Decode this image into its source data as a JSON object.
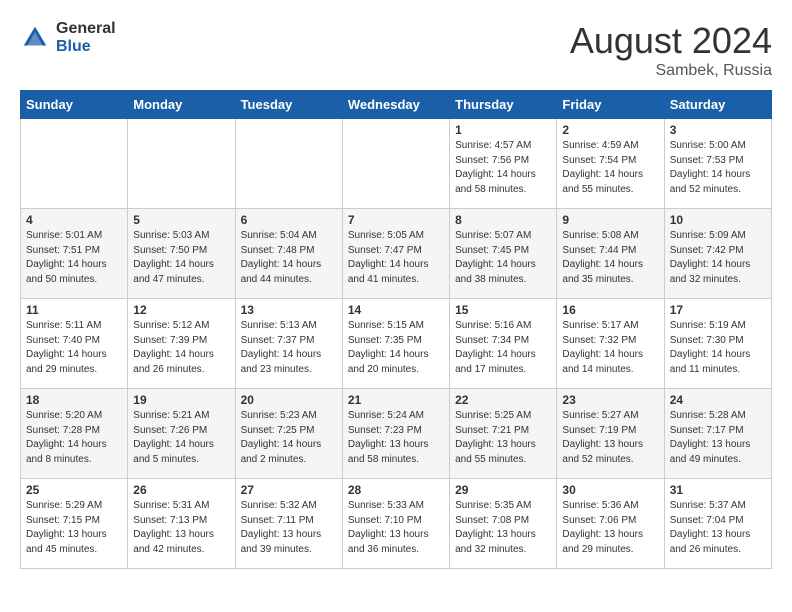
{
  "header": {
    "logo_general": "General",
    "logo_blue": "Blue",
    "month_year": "August 2024",
    "location": "Sambek, Russia"
  },
  "days_of_week": [
    "Sunday",
    "Monday",
    "Tuesday",
    "Wednesday",
    "Thursday",
    "Friday",
    "Saturday"
  ],
  "weeks": [
    [
      {
        "day": "",
        "lines": []
      },
      {
        "day": "",
        "lines": []
      },
      {
        "day": "",
        "lines": []
      },
      {
        "day": "",
        "lines": []
      },
      {
        "day": "1",
        "lines": [
          "Sunrise: 4:57 AM",
          "Sunset: 7:56 PM",
          "Daylight: 14 hours",
          "and 58 minutes."
        ]
      },
      {
        "day": "2",
        "lines": [
          "Sunrise: 4:59 AM",
          "Sunset: 7:54 PM",
          "Daylight: 14 hours",
          "and 55 minutes."
        ]
      },
      {
        "day": "3",
        "lines": [
          "Sunrise: 5:00 AM",
          "Sunset: 7:53 PM",
          "Daylight: 14 hours",
          "and 52 minutes."
        ]
      }
    ],
    [
      {
        "day": "4",
        "lines": [
          "Sunrise: 5:01 AM",
          "Sunset: 7:51 PM",
          "Daylight: 14 hours",
          "and 50 minutes."
        ]
      },
      {
        "day": "5",
        "lines": [
          "Sunrise: 5:03 AM",
          "Sunset: 7:50 PM",
          "Daylight: 14 hours",
          "and 47 minutes."
        ]
      },
      {
        "day": "6",
        "lines": [
          "Sunrise: 5:04 AM",
          "Sunset: 7:48 PM",
          "Daylight: 14 hours",
          "and 44 minutes."
        ]
      },
      {
        "day": "7",
        "lines": [
          "Sunrise: 5:05 AM",
          "Sunset: 7:47 PM",
          "Daylight: 14 hours",
          "and 41 minutes."
        ]
      },
      {
        "day": "8",
        "lines": [
          "Sunrise: 5:07 AM",
          "Sunset: 7:45 PM",
          "Daylight: 14 hours",
          "and 38 minutes."
        ]
      },
      {
        "day": "9",
        "lines": [
          "Sunrise: 5:08 AM",
          "Sunset: 7:44 PM",
          "Daylight: 14 hours",
          "and 35 minutes."
        ]
      },
      {
        "day": "10",
        "lines": [
          "Sunrise: 5:09 AM",
          "Sunset: 7:42 PM",
          "Daylight: 14 hours",
          "and 32 minutes."
        ]
      }
    ],
    [
      {
        "day": "11",
        "lines": [
          "Sunrise: 5:11 AM",
          "Sunset: 7:40 PM",
          "Daylight: 14 hours",
          "and 29 minutes."
        ]
      },
      {
        "day": "12",
        "lines": [
          "Sunrise: 5:12 AM",
          "Sunset: 7:39 PM",
          "Daylight: 14 hours",
          "and 26 minutes."
        ]
      },
      {
        "day": "13",
        "lines": [
          "Sunrise: 5:13 AM",
          "Sunset: 7:37 PM",
          "Daylight: 14 hours",
          "and 23 minutes."
        ]
      },
      {
        "day": "14",
        "lines": [
          "Sunrise: 5:15 AM",
          "Sunset: 7:35 PM",
          "Daylight: 14 hours",
          "and 20 minutes."
        ]
      },
      {
        "day": "15",
        "lines": [
          "Sunrise: 5:16 AM",
          "Sunset: 7:34 PM",
          "Daylight: 14 hours",
          "and 17 minutes."
        ]
      },
      {
        "day": "16",
        "lines": [
          "Sunrise: 5:17 AM",
          "Sunset: 7:32 PM",
          "Daylight: 14 hours",
          "and 14 minutes."
        ]
      },
      {
        "day": "17",
        "lines": [
          "Sunrise: 5:19 AM",
          "Sunset: 7:30 PM",
          "Daylight: 14 hours",
          "and 11 minutes."
        ]
      }
    ],
    [
      {
        "day": "18",
        "lines": [
          "Sunrise: 5:20 AM",
          "Sunset: 7:28 PM",
          "Daylight: 14 hours",
          "and 8 minutes."
        ]
      },
      {
        "day": "19",
        "lines": [
          "Sunrise: 5:21 AM",
          "Sunset: 7:26 PM",
          "Daylight: 14 hours",
          "and 5 minutes."
        ]
      },
      {
        "day": "20",
        "lines": [
          "Sunrise: 5:23 AM",
          "Sunset: 7:25 PM",
          "Daylight: 14 hours",
          "and 2 minutes."
        ]
      },
      {
        "day": "21",
        "lines": [
          "Sunrise: 5:24 AM",
          "Sunset: 7:23 PM",
          "Daylight: 13 hours",
          "and 58 minutes."
        ]
      },
      {
        "day": "22",
        "lines": [
          "Sunrise: 5:25 AM",
          "Sunset: 7:21 PM",
          "Daylight: 13 hours",
          "and 55 minutes."
        ]
      },
      {
        "day": "23",
        "lines": [
          "Sunrise: 5:27 AM",
          "Sunset: 7:19 PM",
          "Daylight: 13 hours",
          "and 52 minutes."
        ]
      },
      {
        "day": "24",
        "lines": [
          "Sunrise: 5:28 AM",
          "Sunset: 7:17 PM",
          "Daylight: 13 hours",
          "and 49 minutes."
        ]
      }
    ],
    [
      {
        "day": "25",
        "lines": [
          "Sunrise: 5:29 AM",
          "Sunset: 7:15 PM",
          "Daylight: 13 hours",
          "and 45 minutes."
        ]
      },
      {
        "day": "26",
        "lines": [
          "Sunrise: 5:31 AM",
          "Sunset: 7:13 PM",
          "Daylight: 13 hours",
          "and 42 minutes."
        ]
      },
      {
        "day": "27",
        "lines": [
          "Sunrise: 5:32 AM",
          "Sunset: 7:11 PM",
          "Daylight: 13 hours",
          "and 39 minutes."
        ]
      },
      {
        "day": "28",
        "lines": [
          "Sunrise: 5:33 AM",
          "Sunset: 7:10 PM",
          "Daylight: 13 hours",
          "and 36 minutes."
        ]
      },
      {
        "day": "29",
        "lines": [
          "Sunrise: 5:35 AM",
          "Sunset: 7:08 PM",
          "Daylight: 13 hours",
          "and 32 minutes."
        ]
      },
      {
        "day": "30",
        "lines": [
          "Sunrise: 5:36 AM",
          "Sunset: 7:06 PM",
          "Daylight: 13 hours",
          "and 29 minutes."
        ]
      },
      {
        "day": "31",
        "lines": [
          "Sunrise: 5:37 AM",
          "Sunset: 7:04 PM",
          "Daylight: 13 hours",
          "and 26 minutes."
        ]
      }
    ]
  ]
}
